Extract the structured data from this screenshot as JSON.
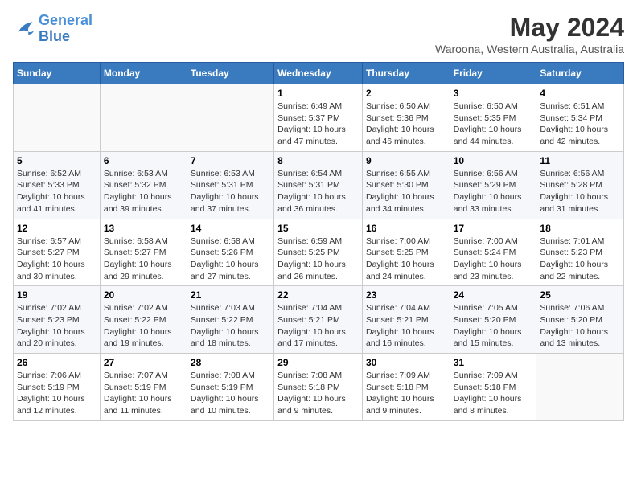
{
  "logo": {
    "line1": "General",
    "line2": "Blue"
  },
  "title": "May 2024",
  "location": "Waroona, Western Australia, Australia",
  "days_of_week": [
    "Sunday",
    "Monday",
    "Tuesday",
    "Wednesday",
    "Thursday",
    "Friday",
    "Saturday"
  ],
  "weeks": [
    [
      {
        "day": "",
        "info": ""
      },
      {
        "day": "",
        "info": ""
      },
      {
        "day": "",
        "info": ""
      },
      {
        "day": "1",
        "info": "Sunrise: 6:49 AM\nSunset: 5:37 PM\nDaylight: 10 hours\nand 47 minutes."
      },
      {
        "day": "2",
        "info": "Sunrise: 6:50 AM\nSunset: 5:36 PM\nDaylight: 10 hours\nand 46 minutes."
      },
      {
        "day": "3",
        "info": "Sunrise: 6:50 AM\nSunset: 5:35 PM\nDaylight: 10 hours\nand 44 minutes."
      },
      {
        "day": "4",
        "info": "Sunrise: 6:51 AM\nSunset: 5:34 PM\nDaylight: 10 hours\nand 42 minutes."
      }
    ],
    [
      {
        "day": "5",
        "info": "Sunrise: 6:52 AM\nSunset: 5:33 PM\nDaylight: 10 hours\nand 41 minutes."
      },
      {
        "day": "6",
        "info": "Sunrise: 6:53 AM\nSunset: 5:32 PM\nDaylight: 10 hours\nand 39 minutes."
      },
      {
        "day": "7",
        "info": "Sunrise: 6:53 AM\nSunset: 5:31 PM\nDaylight: 10 hours\nand 37 minutes."
      },
      {
        "day": "8",
        "info": "Sunrise: 6:54 AM\nSunset: 5:31 PM\nDaylight: 10 hours\nand 36 minutes."
      },
      {
        "day": "9",
        "info": "Sunrise: 6:55 AM\nSunset: 5:30 PM\nDaylight: 10 hours\nand 34 minutes."
      },
      {
        "day": "10",
        "info": "Sunrise: 6:56 AM\nSunset: 5:29 PM\nDaylight: 10 hours\nand 33 minutes."
      },
      {
        "day": "11",
        "info": "Sunrise: 6:56 AM\nSunset: 5:28 PM\nDaylight: 10 hours\nand 31 minutes."
      }
    ],
    [
      {
        "day": "12",
        "info": "Sunrise: 6:57 AM\nSunset: 5:27 PM\nDaylight: 10 hours\nand 30 minutes."
      },
      {
        "day": "13",
        "info": "Sunrise: 6:58 AM\nSunset: 5:27 PM\nDaylight: 10 hours\nand 29 minutes."
      },
      {
        "day": "14",
        "info": "Sunrise: 6:58 AM\nSunset: 5:26 PM\nDaylight: 10 hours\nand 27 minutes."
      },
      {
        "day": "15",
        "info": "Sunrise: 6:59 AM\nSunset: 5:25 PM\nDaylight: 10 hours\nand 26 minutes."
      },
      {
        "day": "16",
        "info": "Sunrise: 7:00 AM\nSunset: 5:25 PM\nDaylight: 10 hours\nand 24 minutes."
      },
      {
        "day": "17",
        "info": "Sunrise: 7:00 AM\nSunset: 5:24 PM\nDaylight: 10 hours\nand 23 minutes."
      },
      {
        "day": "18",
        "info": "Sunrise: 7:01 AM\nSunset: 5:23 PM\nDaylight: 10 hours\nand 22 minutes."
      }
    ],
    [
      {
        "day": "19",
        "info": "Sunrise: 7:02 AM\nSunset: 5:23 PM\nDaylight: 10 hours\nand 20 minutes."
      },
      {
        "day": "20",
        "info": "Sunrise: 7:02 AM\nSunset: 5:22 PM\nDaylight: 10 hours\nand 19 minutes."
      },
      {
        "day": "21",
        "info": "Sunrise: 7:03 AM\nSunset: 5:22 PM\nDaylight: 10 hours\nand 18 minutes."
      },
      {
        "day": "22",
        "info": "Sunrise: 7:04 AM\nSunset: 5:21 PM\nDaylight: 10 hours\nand 17 minutes."
      },
      {
        "day": "23",
        "info": "Sunrise: 7:04 AM\nSunset: 5:21 PM\nDaylight: 10 hours\nand 16 minutes."
      },
      {
        "day": "24",
        "info": "Sunrise: 7:05 AM\nSunset: 5:20 PM\nDaylight: 10 hours\nand 15 minutes."
      },
      {
        "day": "25",
        "info": "Sunrise: 7:06 AM\nSunset: 5:20 PM\nDaylight: 10 hours\nand 13 minutes."
      }
    ],
    [
      {
        "day": "26",
        "info": "Sunrise: 7:06 AM\nSunset: 5:19 PM\nDaylight: 10 hours\nand 12 minutes."
      },
      {
        "day": "27",
        "info": "Sunrise: 7:07 AM\nSunset: 5:19 PM\nDaylight: 10 hours\nand 11 minutes."
      },
      {
        "day": "28",
        "info": "Sunrise: 7:08 AM\nSunset: 5:19 PM\nDaylight: 10 hours\nand 10 minutes."
      },
      {
        "day": "29",
        "info": "Sunrise: 7:08 AM\nSunset: 5:18 PM\nDaylight: 10 hours\nand 9 minutes."
      },
      {
        "day": "30",
        "info": "Sunrise: 7:09 AM\nSunset: 5:18 PM\nDaylight: 10 hours\nand 9 minutes."
      },
      {
        "day": "31",
        "info": "Sunrise: 7:09 AM\nSunset: 5:18 PM\nDaylight: 10 hours\nand 8 minutes."
      },
      {
        "day": "",
        "info": ""
      }
    ]
  ]
}
